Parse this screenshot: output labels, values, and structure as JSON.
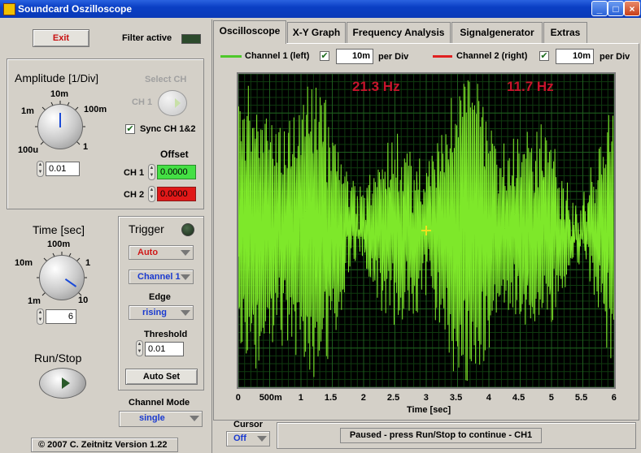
{
  "window": {
    "title": "Soundcard Oszilloscope",
    "controls": [
      "_",
      "□",
      "×"
    ]
  },
  "left": {
    "exit_label": "Exit",
    "filter_active_label": "Filter active",
    "amplitude": {
      "title": "Amplitude",
      "unit": "[1/Div]",
      "dial_labels": [
        "10m",
        "1m",
        "100m",
        "100u",
        "1"
      ],
      "value": "0.01"
    },
    "select_ch": {
      "title": "Select CH",
      "ch_label": "CH 1"
    },
    "sync_label": "Sync CH 1&2",
    "sync_checked": true,
    "offset": {
      "title": "Offset",
      "ch1_label": "CH 1",
      "ch1_value": "0.0000",
      "ch2_label": "CH 2",
      "ch2_value": "0.0000"
    },
    "time": {
      "title": "Time [sec]",
      "dial_labels": [
        "100m",
        "10m",
        "1",
        "1m",
        "10"
      ],
      "value": "6"
    },
    "trigger": {
      "title": "Trigger",
      "mode": "Auto",
      "channel": "Channel 1",
      "edge_label": "Edge",
      "edge": "rising",
      "threshold_label": "Threshold",
      "threshold": "0.01",
      "autoset_label": "Auto Set"
    },
    "runstop_label": "Run/Stop",
    "channel_mode_label": "Channel Mode",
    "channel_mode": "single",
    "copyright": "© 2007  C. Zeitnitz Version 1.22"
  },
  "tabs": [
    {
      "label": "Oscilloscope",
      "active": true
    },
    {
      "label": "X-Y Graph",
      "active": false
    },
    {
      "label": "Frequency Analysis",
      "active": false
    },
    {
      "label": "Signalgenerator",
      "active": false
    },
    {
      "label": "Extras",
      "active": false
    }
  ],
  "channels": {
    "ch1": {
      "label": "Channel 1 (left)",
      "checked": true,
      "per_div": "10m",
      "per_div_label": "per Div",
      "color": "#4ec82a"
    },
    "ch2": {
      "label": "Channel 2 (right)",
      "checked": true,
      "per_div": "10m",
      "per_div_label": "per Div",
      "color": "#e02020"
    }
  },
  "scope": {
    "freq1": "21.3 Hz",
    "freq2": "11.7 Hz",
    "freq_color": "#c8142c",
    "trace_color": "#7ee82a",
    "background": "#000000",
    "grid_color": "#1e5c1e"
  },
  "chart_data": {
    "type": "line",
    "xlabel": "Time [sec]",
    "xlim": [
      0,
      6
    ],
    "x_ticks": [
      "0",
      "500m",
      "1",
      "1.5",
      "2",
      "2.5",
      "3",
      "3.5",
      "4",
      "4.5",
      "5",
      "5.5",
      "6"
    ],
    "series": [
      {
        "name": "Channel 1 (left)",
        "description_values": "dense noisy waveform, approx. amplitude +/-0.85 of screen half-height around center",
        "frequency_hz": 21.3
      }
    ]
  },
  "bottom": {
    "cursor_label": "Cursor",
    "cursor_value": "Off",
    "status": "Paused - press Run/Stop to continue - CH1"
  }
}
